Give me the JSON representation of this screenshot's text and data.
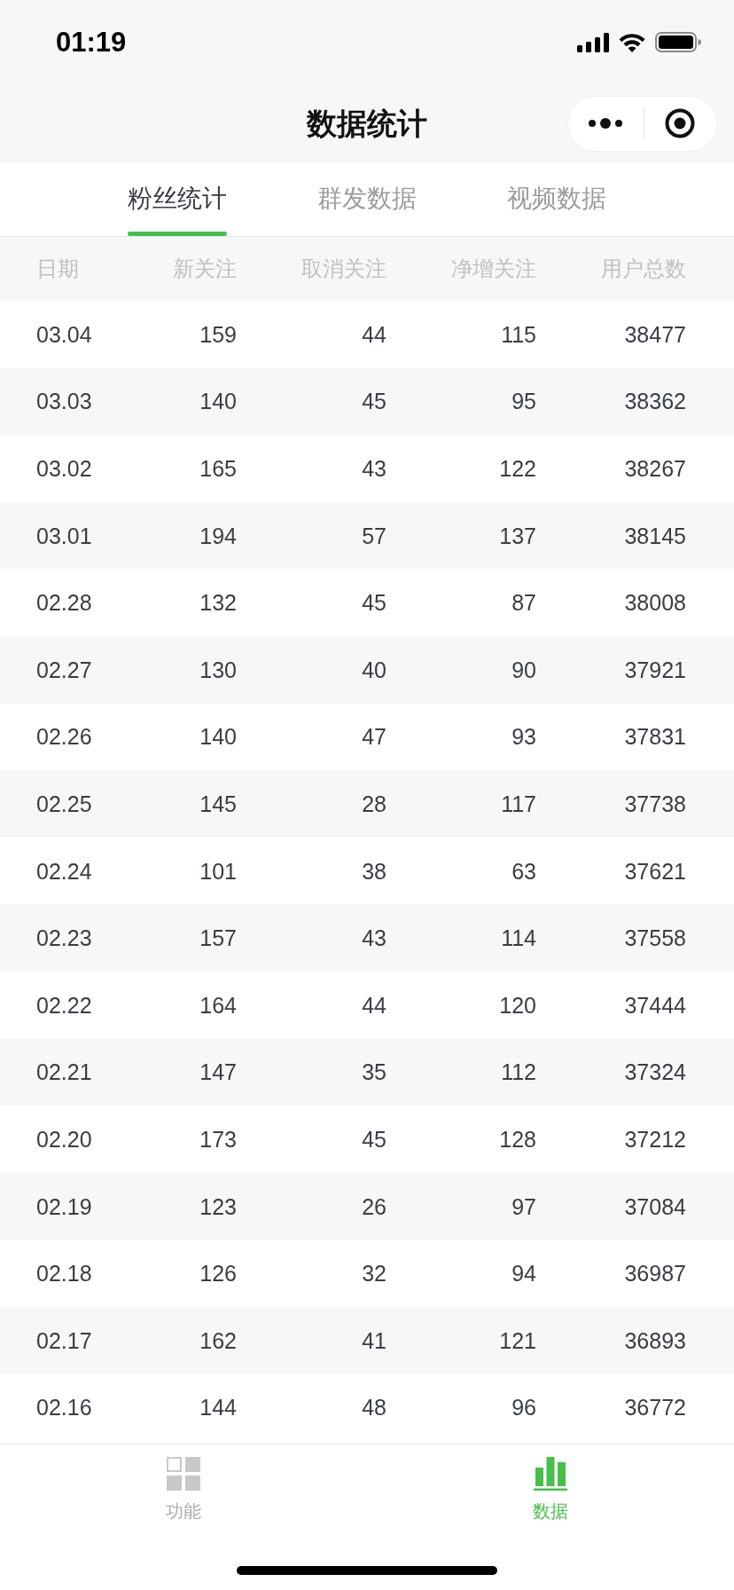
{
  "status_bar": {
    "time": "01:19"
  },
  "nav_bar": {
    "title": "数据统计"
  },
  "tabs": [
    {
      "label": "粉丝统计",
      "selected": true
    },
    {
      "label": "群发数据",
      "selected": false
    },
    {
      "label": "视频数据",
      "selected": false
    }
  ],
  "table": {
    "columns": [
      "日期",
      "新关注",
      "取消关注",
      "净增关注",
      "用户总数"
    ],
    "rows": [
      [
        "03.04",
        "159",
        "44",
        "115",
        "38477"
      ],
      [
        "03.03",
        "140",
        "45",
        "95",
        "38362"
      ],
      [
        "03.02",
        "165",
        "43",
        "122",
        "38267"
      ],
      [
        "03.01",
        "194",
        "57",
        "137",
        "38145"
      ],
      [
        "02.28",
        "132",
        "45",
        "87",
        "38008"
      ],
      [
        "02.27",
        "130",
        "40",
        "90",
        "37921"
      ],
      [
        "02.26",
        "140",
        "47",
        "93",
        "37831"
      ],
      [
        "02.25",
        "145",
        "28",
        "117",
        "37738"
      ],
      [
        "02.24",
        "101",
        "38",
        "63",
        "37621"
      ],
      [
        "02.23",
        "157",
        "43",
        "114",
        "37558"
      ],
      [
        "02.22",
        "164",
        "44",
        "120",
        "37444"
      ],
      [
        "02.21",
        "147",
        "35",
        "112",
        "37324"
      ],
      [
        "02.20",
        "173",
        "45",
        "128",
        "37212"
      ],
      [
        "02.19",
        "123",
        "26",
        "97",
        "37084"
      ],
      [
        "02.18",
        "126",
        "32",
        "94",
        "36987"
      ],
      [
        "02.17",
        "162",
        "41",
        "121",
        "36893"
      ],
      [
        "02.16",
        "144",
        "48",
        "96",
        "36772"
      ]
    ]
  },
  "tab_bar": [
    {
      "label": "功能",
      "selected": false
    },
    {
      "label": "数据",
      "selected": true
    }
  ]
}
